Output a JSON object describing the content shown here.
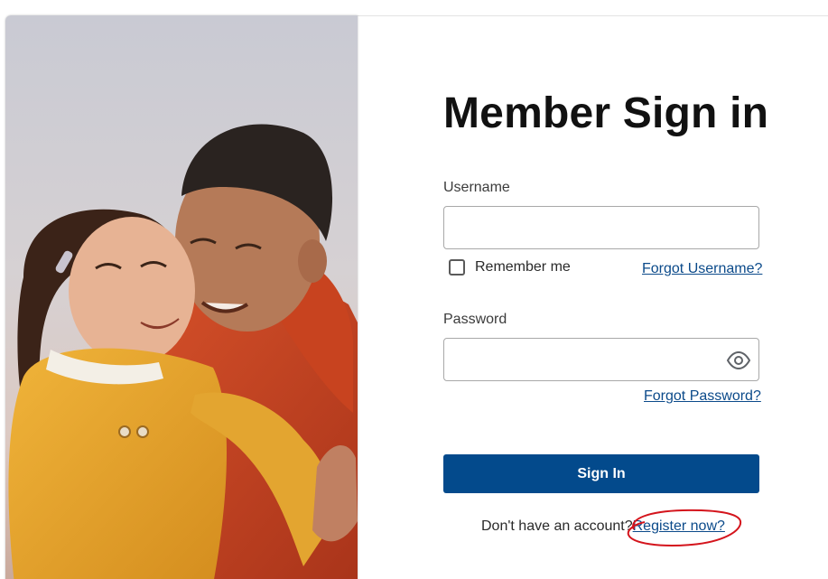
{
  "title": "Member Sign in",
  "username": {
    "label": "Username",
    "value": "",
    "placeholder": ""
  },
  "remember_me": {
    "label": "Remember me",
    "checked": false
  },
  "forgot_username": "Forgot Username?",
  "password": {
    "label": "Password",
    "value": "",
    "placeholder": ""
  },
  "show_password_icon": "eye-icon",
  "forgot_password": "Forgot Password?",
  "sign_in": "Sign In",
  "register": {
    "prompt": "Don't have an account?",
    "link": "Register now?"
  },
  "colors": {
    "primary_button": "#034a8c",
    "link": "#0b4a8a",
    "annotation": "#d4141c"
  }
}
